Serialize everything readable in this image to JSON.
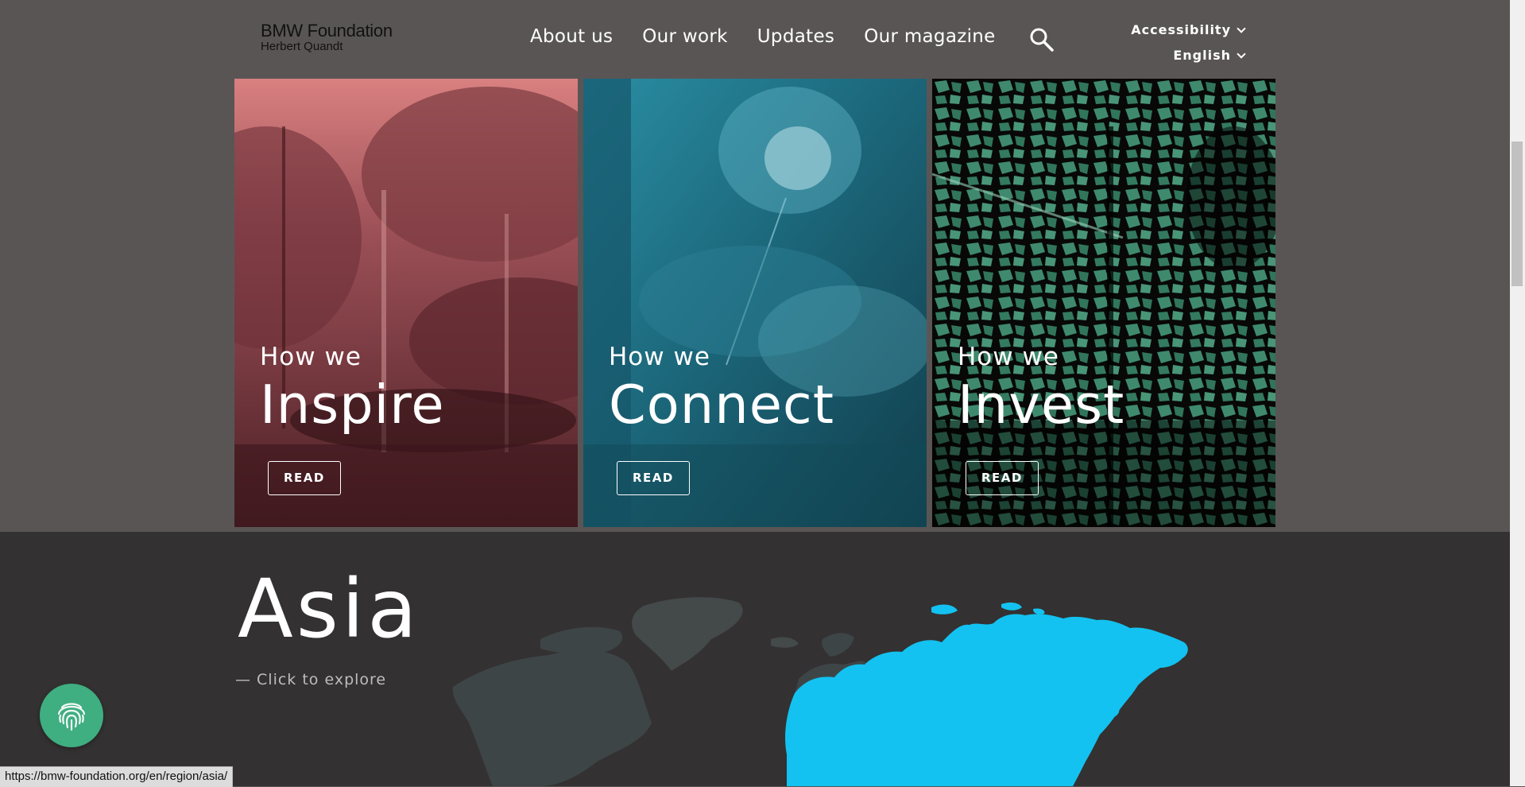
{
  "logo": {
    "line1": "BMW Foundation",
    "line2": "Herbert Quandt"
  },
  "nav": {
    "items": [
      "About us",
      "Our work",
      "Updates",
      "Our magazine"
    ]
  },
  "utility": {
    "accessibility": "Accessibility",
    "language": "English"
  },
  "cards": [
    {
      "small": "How we",
      "big": "Inspire",
      "button": "READ",
      "color": "#c46a6a"
    },
    {
      "small": "How we",
      "big": "Connect",
      "button": "READ",
      "color": "#1f6f82"
    },
    {
      "small": "How we",
      "big": "Invest",
      "button": "READ",
      "color": "#3c8f74"
    }
  ],
  "region": {
    "title": "Asia",
    "subtitle": "— Click to explore",
    "highlight_color": "#13c2f0"
  },
  "status_url": "https://bmw-foundation.org/en/region/asia/",
  "icons": {
    "search": "search-icon",
    "fingerprint": "fingerprint-icon",
    "chevron": "chevron-down-icon"
  }
}
